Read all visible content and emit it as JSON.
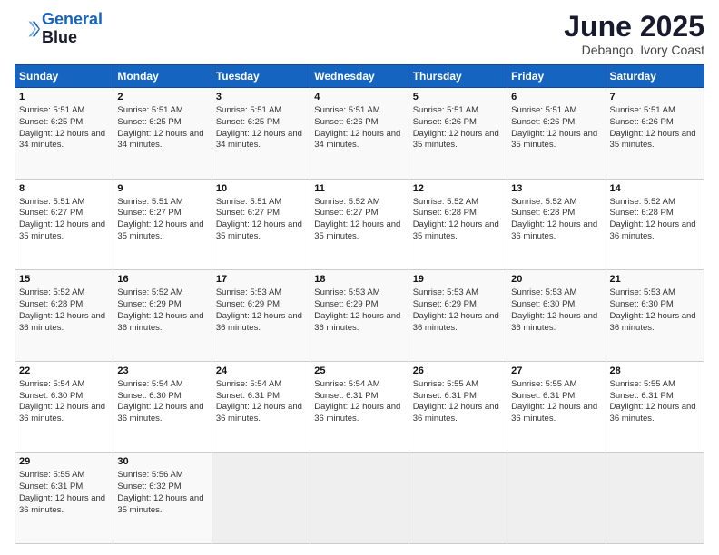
{
  "header": {
    "logo_line1": "General",
    "logo_line2": "Blue",
    "main_title": "June 2025",
    "subtitle": "Debango, Ivory Coast"
  },
  "weekdays": [
    "Sunday",
    "Monday",
    "Tuesday",
    "Wednesday",
    "Thursday",
    "Friday",
    "Saturday"
  ],
  "weeks": [
    [
      {
        "day": 1,
        "sunrise": "5:51 AM",
        "sunset": "6:25 PM",
        "daylight": "12 hours and 34 minutes."
      },
      {
        "day": 2,
        "sunrise": "5:51 AM",
        "sunset": "6:25 PM",
        "daylight": "12 hours and 34 minutes."
      },
      {
        "day": 3,
        "sunrise": "5:51 AM",
        "sunset": "6:25 PM",
        "daylight": "12 hours and 34 minutes."
      },
      {
        "day": 4,
        "sunrise": "5:51 AM",
        "sunset": "6:26 PM",
        "daylight": "12 hours and 34 minutes."
      },
      {
        "day": 5,
        "sunrise": "5:51 AM",
        "sunset": "6:26 PM",
        "daylight": "12 hours and 35 minutes."
      },
      {
        "day": 6,
        "sunrise": "5:51 AM",
        "sunset": "6:26 PM",
        "daylight": "12 hours and 35 minutes."
      },
      {
        "day": 7,
        "sunrise": "5:51 AM",
        "sunset": "6:26 PM",
        "daylight": "12 hours and 35 minutes."
      }
    ],
    [
      {
        "day": 8,
        "sunrise": "5:51 AM",
        "sunset": "6:27 PM",
        "daylight": "12 hours and 35 minutes."
      },
      {
        "day": 9,
        "sunrise": "5:51 AM",
        "sunset": "6:27 PM",
        "daylight": "12 hours and 35 minutes."
      },
      {
        "day": 10,
        "sunrise": "5:51 AM",
        "sunset": "6:27 PM",
        "daylight": "12 hours and 35 minutes."
      },
      {
        "day": 11,
        "sunrise": "5:52 AM",
        "sunset": "6:27 PM",
        "daylight": "12 hours and 35 minutes."
      },
      {
        "day": 12,
        "sunrise": "5:52 AM",
        "sunset": "6:28 PM",
        "daylight": "12 hours and 35 minutes."
      },
      {
        "day": 13,
        "sunrise": "5:52 AM",
        "sunset": "6:28 PM",
        "daylight": "12 hours and 36 minutes."
      },
      {
        "day": 14,
        "sunrise": "5:52 AM",
        "sunset": "6:28 PM",
        "daylight": "12 hours and 36 minutes."
      }
    ],
    [
      {
        "day": 15,
        "sunrise": "5:52 AM",
        "sunset": "6:28 PM",
        "daylight": "12 hours and 36 minutes."
      },
      {
        "day": 16,
        "sunrise": "5:52 AM",
        "sunset": "6:29 PM",
        "daylight": "12 hours and 36 minutes."
      },
      {
        "day": 17,
        "sunrise": "5:53 AM",
        "sunset": "6:29 PM",
        "daylight": "12 hours and 36 minutes."
      },
      {
        "day": 18,
        "sunrise": "5:53 AM",
        "sunset": "6:29 PM",
        "daylight": "12 hours and 36 minutes."
      },
      {
        "day": 19,
        "sunrise": "5:53 AM",
        "sunset": "6:29 PM",
        "daylight": "12 hours and 36 minutes."
      },
      {
        "day": 20,
        "sunrise": "5:53 AM",
        "sunset": "6:30 PM",
        "daylight": "12 hours and 36 minutes."
      },
      {
        "day": 21,
        "sunrise": "5:53 AM",
        "sunset": "6:30 PM",
        "daylight": "12 hours and 36 minutes."
      }
    ],
    [
      {
        "day": 22,
        "sunrise": "5:54 AM",
        "sunset": "6:30 PM",
        "daylight": "12 hours and 36 minutes."
      },
      {
        "day": 23,
        "sunrise": "5:54 AM",
        "sunset": "6:30 PM",
        "daylight": "12 hours and 36 minutes."
      },
      {
        "day": 24,
        "sunrise": "5:54 AM",
        "sunset": "6:31 PM",
        "daylight": "12 hours and 36 minutes."
      },
      {
        "day": 25,
        "sunrise": "5:54 AM",
        "sunset": "6:31 PM",
        "daylight": "12 hours and 36 minutes."
      },
      {
        "day": 26,
        "sunrise": "5:55 AM",
        "sunset": "6:31 PM",
        "daylight": "12 hours and 36 minutes."
      },
      {
        "day": 27,
        "sunrise": "5:55 AM",
        "sunset": "6:31 PM",
        "daylight": "12 hours and 36 minutes."
      },
      {
        "day": 28,
        "sunrise": "5:55 AM",
        "sunset": "6:31 PM",
        "daylight": "12 hours and 36 minutes."
      }
    ],
    [
      {
        "day": 29,
        "sunrise": "5:55 AM",
        "sunset": "6:31 PM",
        "daylight": "12 hours and 36 minutes."
      },
      {
        "day": 30,
        "sunrise": "5:56 AM",
        "sunset": "6:32 PM",
        "daylight": "12 hours and 35 minutes."
      },
      null,
      null,
      null,
      null,
      null
    ]
  ]
}
